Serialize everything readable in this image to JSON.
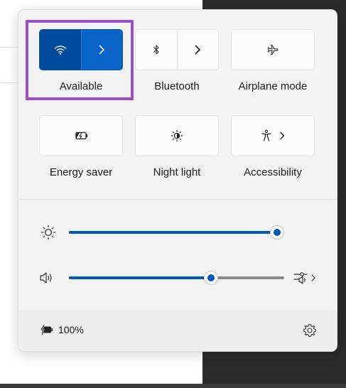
{
  "tiles": [
    {
      "label": "Available",
      "icon": "wifi-icon",
      "active": true
    },
    {
      "label": "Bluetooth",
      "icon": "bluetooth-icon",
      "active": false
    },
    {
      "label": "Airplane mode",
      "icon": "airplane-icon",
      "active": false
    },
    {
      "label": "Energy saver",
      "icon": "energy-saver-icon",
      "active": false
    },
    {
      "label": "Night light",
      "icon": "night-light-icon",
      "active": false
    },
    {
      "label": "Accessibility",
      "icon": "accessibility-icon",
      "active": false
    }
  ],
  "brightness": {
    "icon": "brightness-icon",
    "level": 1.0
  },
  "volume": {
    "icon": "speaker-icon",
    "level": 0.66,
    "output_icon": "audio-output-icon"
  },
  "battery": {
    "icon": "battery-charging-icon",
    "text": "100%"
  },
  "settings_icon": "gear-icon",
  "colors": {
    "accent": "#0059b8",
    "highlight": "#9b4dca",
    "panel": "#f3f3f3"
  }
}
